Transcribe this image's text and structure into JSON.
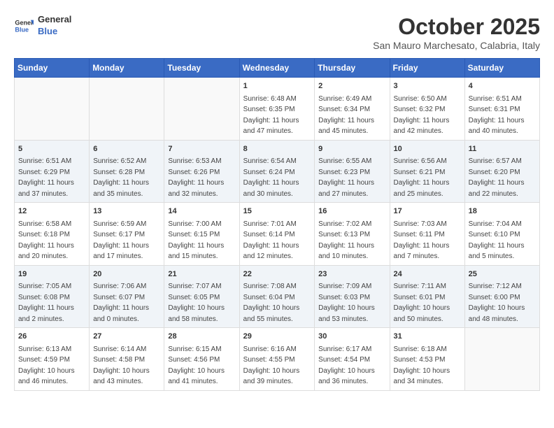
{
  "header": {
    "logo_line1": "General",
    "logo_line2": "Blue",
    "month": "October 2025",
    "location": "San Mauro Marchesato, Calabria, Italy"
  },
  "days_of_week": [
    "Sunday",
    "Monday",
    "Tuesday",
    "Wednesday",
    "Thursday",
    "Friday",
    "Saturday"
  ],
  "weeks": [
    [
      {
        "day": "",
        "info": ""
      },
      {
        "day": "",
        "info": ""
      },
      {
        "day": "",
        "info": ""
      },
      {
        "day": "1",
        "info": "Sunrise: 6:48 AM\nSunset: 6:35 PM\nDaylight: 11 hours\nand 47 minutes."
      },
      {
        "day": "2",
        "info": "Sunrise: 6:49 AM\nSunset: 6:34 PM\nDaylight: 11 hours\nand 45 minutes."
      },
      {
        "day": "3",
        "info": "Sunrise: 6:50 AM\nSunset: 6:32 PM\nDaylight: 11 hours\nand 42 minutes."
      },
      {
        "day": "4",
        "info": "Sunrise: 6:51 AM\nSunset: 6:31 PM\nDaylight: 11 hours\nand 40 minutes."
      }
    ],
    [
      {
        "day": "5",
        "info": "Sunrise: 6:51 AM\nSunset: 6:29 PM\nDaylight: 11 hours\nand 37 minutes."
      },
      {
        "day": "6",
        "info": "Sunrise: 6:52 AM\nSunset: 6:28 PM\nDaylight: 11 hours\nand 35 minutes."
      },
      {
        "day": "7",
        "info": "Sunrise: 6:53 AM\nSunset: 6:26 PM\nDaylight: 11 hours\nand 32 minutes."
      },
      {
        "day": "8",
        "info": "Sunrise: 6:54 AM\nSunset: 6:24 PM\nDaylight: 11 hours\nand 30 minutes."
      },
      {
        "day": "9",
        "info": "Sunrise: 6:55 AM\nSunset: 6:23 PM\nDaylight: 11 hours\nand 27 minutes."
      },
      {
        "day": "10",
        "info": "Sunrise: 6:56 AM\nSunset: 6:21 PM\nDaylight: 11 hours\nand 25 minutes."
      },
      {
        "day": "11",
        "info": "Sunrise: 6:57 AM\nSunset: 6:20 PM\nDaylight: 11 hours\nand 22 minutes."
      }
    ],
    [
      {
        "day": "12",
        "info": "Sunrise: 6:58 AM\nSunset: 6:18 PM\nDaylight: 11 hours\nand 20 minutes."
      },
      {
        "day": "13",
        "info": "Sunrise: 6:59 AM\nSunset: 6:17 PM\nDaylight: 11 hours\nand 17 minutes."
      },
      {
        "day": "14",
        "info": "Sunrise: 7:00 AM\nSunset: 6:15 PM\nDaylight: 11 hours\nand 15 minutes."
      },
      {
        "day": "15",
        "info": "Sunrise: 7:01 AM\nSunset: 6:14 PM\nDaylight: 11 hours\nand 12 minutes."
      },
      {
        "day": "16",
        "info": "Sunrise: 7:02 AM\nSunset: 6:13 PM\nDaylight: 11 hours\nand 10 minutes."
      },
      {
        "day": "17",
        "info": "Sunrise: 7:03 AM\nSunset: 6:11 PM\nDaylight: 11 hours\nand 7 minutes."
      },
      {
        "day": "18",
        "info": "Sunrise: 7:04 AM\nSunset: 6:10 PM\nDaylight: 11 hours\nand 5 minutes."
      }
    ],
    [
      {
        "day": "19",
        "info": "Sunrise: 7:05 AM\nSunset: 6:08 PM\nDaylight: 11 hours\nand 2 minutes."
      },
      {
        "day": "20",
        "info": "Sunrise: 7:06 AM\nSunset: 6:07 PM\nDaylight: 11 hours\nand 0 minutes."
      },
      {
        "day": "21",
        "info": "Sunrise: 7:07 AM\nSunset: 6:05 PM\nDaylight: 10 hours\nand 58 minutes."
      },
      {
        "day": "22",
        "info": "Sunrise: 7:08 AM\nSunset: 6:04 PM\nDaylight: 10 hours\nand 55 minutes."
      },
      {
        "day": "23",
        "info": "Sunrise: 7:09 AM\nSunset: 6:03 PM\nDaylight: 10 hours\nand 53 minutes."
      },
      {
        "day": "24",
        "info": "Sunrise: 7:11 AM\nSunset: 6:01 PM\nDaylight: 10 hours\nand 50 minutes."
      },
      {
        "day": "25",
        "info": "Sunrise: 7:12 AM\nSunset: 6:00 PM\nDaylight: 10 hours\nand 48 minutes."
      }
    ],
    [
      {
        "day": "26",
        "info": "Sunrise: 6:13 AM\nSunset: 4:59 PM\nDaylight: 10 hours\nand 46 minutes."
      },
      {
        "day": "27",
        "info": "Sunrise: 6:14 AM\nSunset: 4:58 PM\nDaylight: 10 hours\nand 43 minutes."
      },
      {
        "day": "28",
        "info": "Sunrise: 6:15 AM\nSunset: 4:56 PM\nDaylight: 10 hours\nand 41 minutes."
      },
      {
        "day": "29",
        "info": "Sunrise: 6:16 AM\nSunset: 4:55 PM\nDaylight: 10 hours\nand 39 minutes."
      },
      {
        "day": "30",
        "info": "Sunrise: 6:17 AM\nSunset: 4:54 PM\nDaylight: 10 hours\nand 36 minutes."
      },
      {
        "day": "31",
        "info": "Sunrise: 6:18 AM\nSunset: 4:53 PM\nDaylight: 10 hours\nand 34 minutes."
      },
      {
        "day": "",
        "info": ""
      }
    ]
  ]
}
